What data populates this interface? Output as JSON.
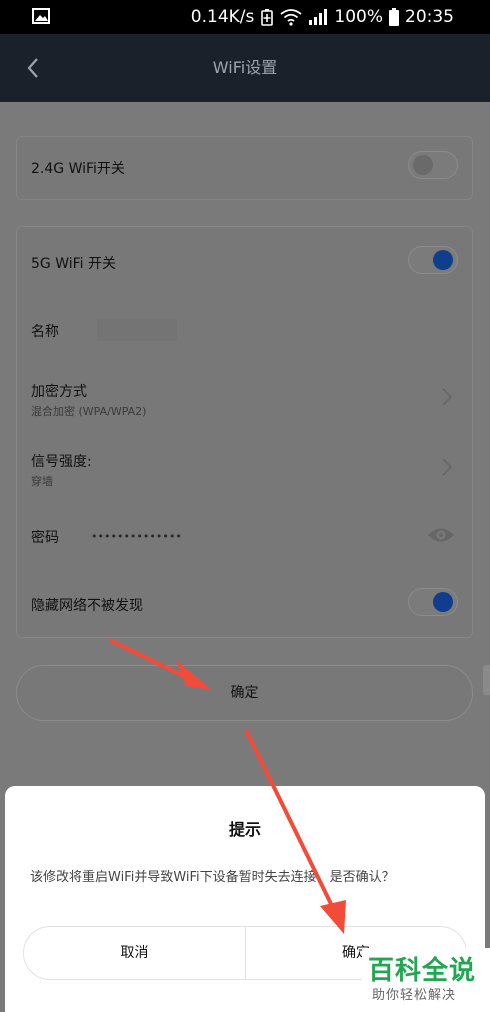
{
  "status_bar": {
    "speed": "0.14K/s",
    "battery_percent": "100%",
    "time": "20:35",
    "icons": [
      "gallery-icon",
      "battery-saver-icon",
      "wifi-icon",
      "signal-icon",
      "battery-icon"
    ]
  },
  "nav": {
    "title": "WiFi设置",
    "back_icon": "chevron-left-icon"
  },
  "wifi24": {
    "label": "2.4G WiFi开关",
    "enabled": false
  },
  "wifi5": {
    "toggle_label": "5G WiFi 开关",
    "enabled": true,
    "name_label": "名称",
    "encryption_label": "加密方式",
    "encryption_value": "混合加密 (WPA/WPA2)",
    "signal_label": "信号强度:",
    "signal_value": "穿墙",
    "password_label": "密码",
    "password_value": "••••••••••••••",
    "hide_label": "隐藏网络不被发现",
    "hide_enabled": true
  },
  "confirm_button": "确定",
  "dialog": {
    "title": "提示",
    "message": "该修改将重启WiFi并导致WiFi下设备暂时失去连接，是否确认？",
    "cancel": "取消",
    "ok": "确定"
  },
  "watermark": {
    "main": "百科全说",
    "sub": "助你轻松解决"
  },
  "colors": {
    "toggle_on": "#0f3f8c",
    "arrow": "#f24b3a",
    "nav_bg": "#1b212a",
    "watermark_green": "#23a651"
  }
}
